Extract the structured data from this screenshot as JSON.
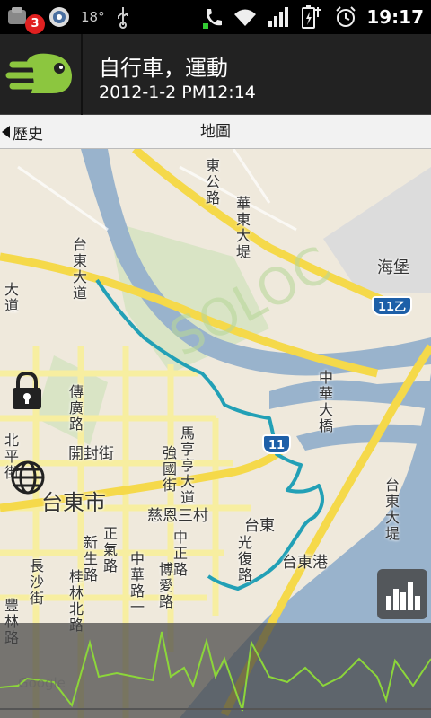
{
  "status_bar": {
    "notification_count": "3",
    "temperature": "18°",
    "time": "19:17",
    "icons": [
      "notification-icon",
      "app-icon",
      "usb-icon",
      "phone-icon",
      "wifi-icon",
      "signal-icon",
      "battery-icon",
      "alarm-icon"
    ]
  },
  "header": {
    "title": "自行車，運動",
    "subtitle": "2012-1-2 PM12:14",
    "logo_icon": "app-logo-icon"
  },
  "tabs": {
    "back_label": "歷史",
    "current_label": "地圖"
  },
  "map": {
    "labels": {
      "haibao": "海堡",
      "taitung_city": "台東市",
      "kaifeng": "開封街",
      "ciensan": "慈恩三村",
      "taitung": "台東",
      "taitung_port": "台東港",
      "changsha": "長沙街",
      "chuanguang": "傳廣路",
      "road_11": "11",
      "road_11b": "11乙",
      "zhonghua_bridge": "中華大橋",
      "mahengheng": "馬亨亨大道",
      "qiangguo": "強國街",
      "zhengqi": "正氣路",
      "xinsheng": "新生路",
      "zhonghua1": "中華路一",
      "zhongzheng": "中正路",
      "bohai": "博愛路",
      "guilin": "桂林北路",
      "guangfu": "光復路",
      "taitung_dadao": "台東大道",
      "beiping": "北平街",
      "dadao": "大道",
      "dongfu": "東公路",
      "huadong": "華東大堤",
      "taitung_dadi": "台東大堤",
      "fenglin": "豐林路",
      "watermark": "SOLOC",
      "attribution": "Google"
    },
    "route_color": "#22a0b6"
  },
  "controls": {
    "lock_icon": "lock-icon",
    "globe_icon": "globe-icon",
    "chart_icon": "bar-chart-icon"
  }
}
